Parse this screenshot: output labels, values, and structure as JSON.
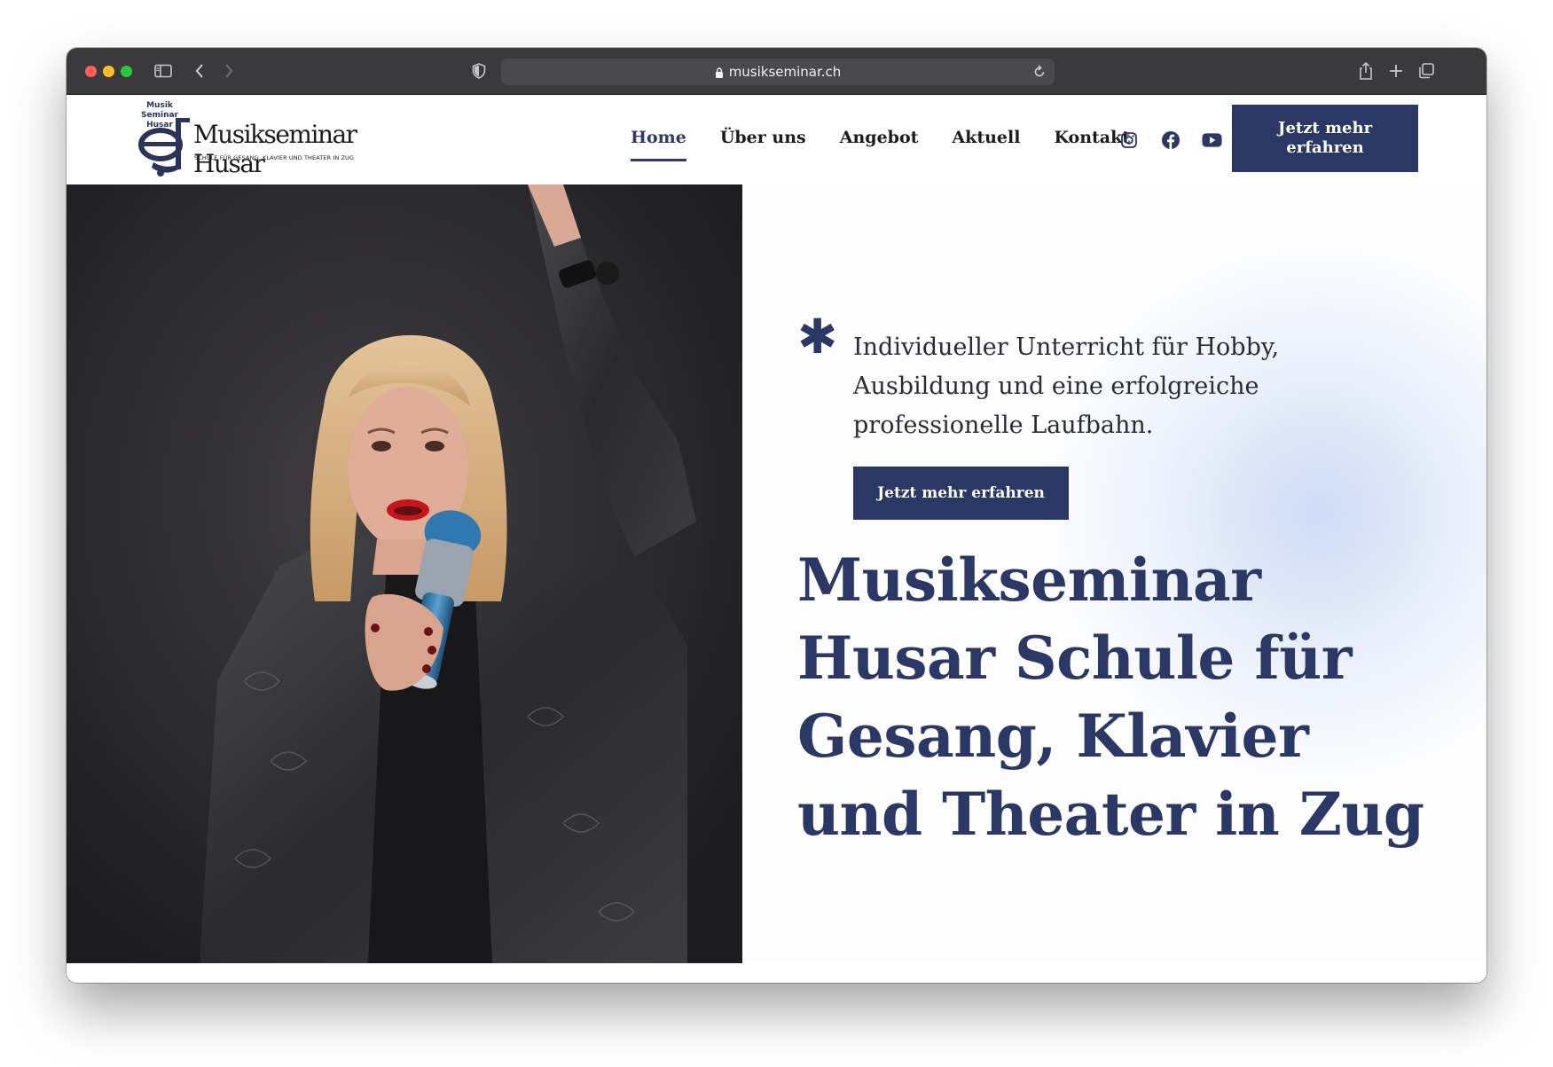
{
  "browser": {
    "url": "musikseminar.ch"
  },
  "logo": {
    "small_line1": "Musik",
    "small_line2": "Seminar",
    "small_line3": "Husar",
    "name": "Musikseminar Husar",
    "tagline": "SCHULE FÜR GESANG, KLAVIER UND THEATER IN ZUG"
  },
  "nav": {
    "items": [
      {
        "label": "Home",
        "active": true
      },
      {
        "label": "Über uns",
        "active": false
      },
      {
        "label": "Angebot",
        "active": false
      },
      {
        "label": "Aktuell",
        "active": false
      },
      {
        "label": "Kontakt",
        "active": false
      }
    ]
  },
  "socials": [
    "instagram-icon",
    "facebook-icon",
    "youtube-icon"
  ],
  "header_cta": "Jetzt mehr erfahren",
  "hero": {
    "intro": "Individueller Unterricht für Hobby, Ausbildung und eine erfolgreiche professionelle Laufbahn.",
    "cta": "Jetzt mehr erfahren",
    "headline": "Musikseminar Husar Schule für Gesang, Klavier und Theater in Zug"
  },
  "colors": {
    "brand": "#2b3764",
    "chrome": "#3a3a3c"
  }
}
